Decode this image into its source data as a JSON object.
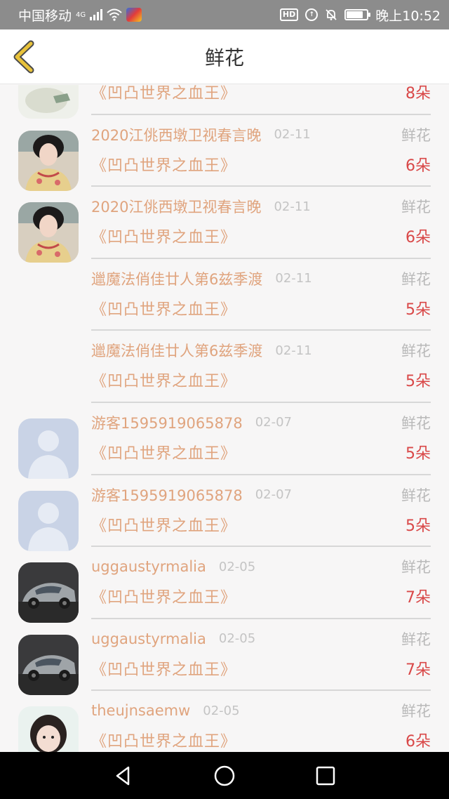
{
  "status_bar": {
    "carrier": "中国移动",
    "network": "4G",
    "time": "晚上10:52",
    "hd": "HD"
  },
  "header": {
    "title": "鲜花"
  },
  "list": [
    {
      "name": "",
      "date": "",
      "type": "",
      "work": "《凹凸世界之血王》",
      "count": "8朵",
      "avatar": "partial-photo-avatar"
    },
    {
      "name": "2020江佻西墩卫视春言晚",
      "date": "02-11",
      "type": "鲜花",
      "work": "《凹凸世界之血王》",
      "count": "6朵",
      "avatar": "woman-photo-avatar"
    },
    {
      "name": "2020江佻西墩卫视春言晚",
      "date": "02-11",
      "type": "鲜花",
      "work": "《凹凸世界之血王》",
      "count": "6朵",
      "avatar": "woman-photo-avatar"
    },
    {
      "name": "邋魔法俏佳廿人第6兹季渡",
      "date": "02-11",
      "type": "鲜花",
      "work": "《凹凸世界之血王》",
      "count": "5朵",
      "avatar": ""
    },
    {
      "name": "邋魔法俏佳廿人第6兹季渡",
      "date": "02-11",
      "type": "鲜花",
      "work": "《凹凸世界之血王》",
      "count": "5朵",
      "avatar": ""
    },
    {
      "name": "游客1595919065878",
      "date": "02-07",
      "type": "鲜花",
      "work": "《凹凸世界之血王》",
      "count": "5朵",
      "avatar": "default-user-avatar"
    },
    {
      "name": "游客1595919065878",
      "date": "02-07",
      "type": "鲜花",
      "work": "《凹凸世界之血王》",
      "count": "5朵",
      "avatar": "default-user-avatar"
    },
    {
      "name": "uggaustyrmalia",
      "date": "02-05",
      "type": "鲜花",
      "work": "《凹凸世界之血王》",
      "count": "7朵",
      "avatar": "car-photo-avatar"
    },
    {
      "name": "uggaustyrmalia",
      "date": "02-05",
      "type": "鲜花",
      "work": "《凹凸世界之血王》",
      "count": "7朵",
      "avatar": "car-photo-avatar"
    },
    {
      "name": "theujnsaemw",
      "date": "02-05",
      "type": "鲜花",
      "work": "《凹凸世界之血王》",
      "count": "6朵",
      "avatar": "child-photo-avatar"
    }
  ],
  "colors": {
    "accent_text": "#e0a47e",
    "count_red": "#d94848",
    "status_bar_bg": "#8c8c8c",
    "back_icon": "#e8c23a"
  },
  "icons": {
    "back": "chevron-left-icon",
    "nav_back": "triangle-back-icon",
    "nav_home": "circle-home-icon",
    "nav_recent": "square-recent-icon"
  }
}
